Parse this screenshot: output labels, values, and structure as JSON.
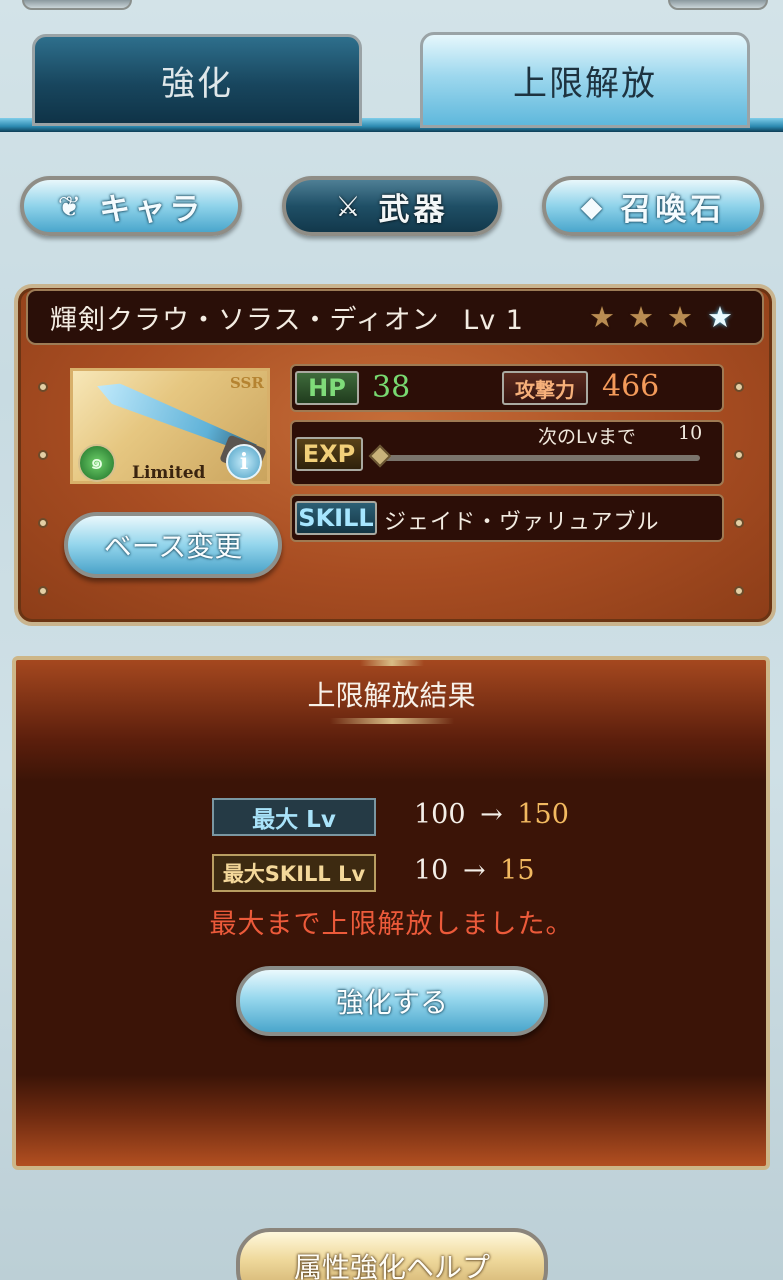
{
  "tabs": {
    "enhance": "強化",
    "limit_break": "上限解放"
  },
  "categories": {
    "chara": "キャラ",
    "weapon": "武器",
    "summon": "召喚石"
  },
  "weapon": {
    "name": "輝剣クラウ・ソラス・ディオン",
    "level_label": "Lv 1",
    "stars": [
      "gold",
      "gold",
      "gold",
      "blue"
    ],
    "rarity": "SSR",
    "limited": "Limited",
    "info_symbol": "i",
    "base_change": "ベース変更",
    "hp_label": "HP",
    "hp": "38",
    "atk_label": "攻撃力",
    "atk": "466",
    "exp_label": "EXP",
    "next_lv_label": "次のLvまで",
    "next_lv_value": "10",
    "exp_progress": 0,
    "skill_label": "SKILL",
    "skill_name": "ジェイド・ヴァリュアブル"
  },
  "result": {
    "title": "上限解放結果",
    "max_lv_label": "最大 Lv",
    "max_lv_before": "100",
    "max_lv_after": "150",
    "max_skill_label": "最大SKILL Lv",
    "max_skill_before": "10",
    "max_skill_after": "15",
    "arrow": "→",
    "message": "最大まで上限解放しました。",
    "enhance_button": "強化する"
  },
  "help_button": "属性強化ヘルプ",
  "colors": {
    "accent_blue": "#4aa6cc",
    "panel_brown": "#a84d22",
    "message_red": "#ec5a3a",
    "after_value": "#f2b960"
  }
}
